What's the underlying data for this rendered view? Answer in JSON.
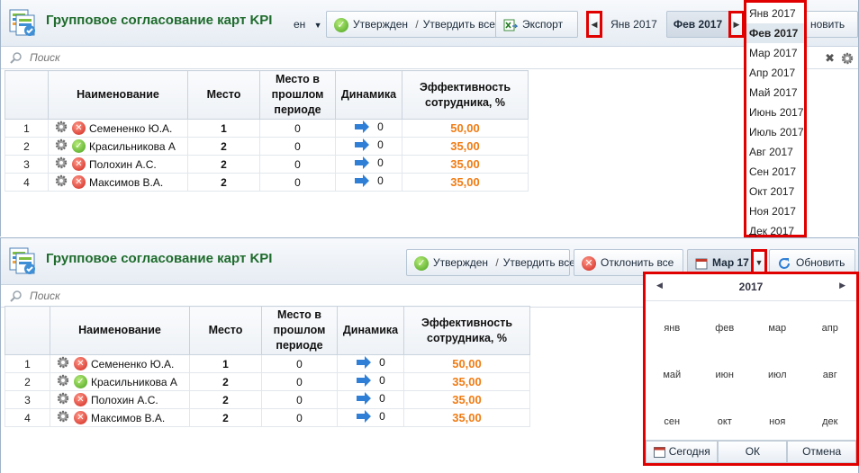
{
  "panel1": {
    "title": "Групповое согласование карт KPI",
    "toolbar": {
      "cut_label": "ен",
      "approve_label": "Утвержден",
      "approve_all_label": "Утвердить все",
      "separator": "/",
      "export_label": "Экспорт",
      "month_prev": "Янв 2017",
      "month_current": "Фев 2017",
      "refresh_label": "новить"
    },
    "search_placeholder": "Поиск"
  },
  "panel2": {
    "title": "Групповое согласование карт KPI",
    "toolbar": {
      "approve_label": "Утвержден",
      "separator": "/",
      "approve_all_label": "Утвердить все",
      "reject_all_label": "Отклонить все",
      "month_value": "Мар 17",
      "refresh_label": "Обновить"
    },
    "search_placeholder": "Поиск"
  },
  "columns": {
    "name": "Наименование",
    "place": "Место",
    "prev": "Место в прошлом периоде",
    "dynamics": "Динамика",
    "efficiency": "Эффективность сотрудника, %"
  },
  "rows": [
    {
      "num": "1",
      "name": "Семененко Ю.А.",
      "status": "rejected",
      "place": "1",
      "prev": "0",
      "dyn": "0",
      "eff": "50,00"
    },
    {
      "num": "2",
      "name": "Красильникова А",
      "status": "approved",
      "place": "2",
      "prev": "0",
      "dyn": "0",
      "eff": "35,00"
    },
    {
      "num": "3",
      "name": "Полохин А.С.",
      "status": "rejected",
      "place": "2",
      "prev": "0",
      "dyn": "0",
      "eff": "35,00"
    },
    {
      "num": "4",
      "name": "Максимов В.А.",
      "status": "rejected",
      "place": "2",
      "prev": "0",
      "dyn": "0",
      "eff": "35,00"
    }
  ],
  "month_dropdown": [
    "Янв 2017",
    "Фев 2017",
    "Мар 2017",
    "Апр 2017",
    "Май 2017",
    "Июнь 2017",
    "Июль 2017",
    "Авг 2017",
    "Сен 2017",
    "Окт 2017",
    "Ноя 2017",
    "Дек 2017"
  ],
  "month_dropdown_selected": "Фев 2017",
  "calendar": {
    "year": "2017",
    "months": [
      "янв",
      "фев",
      "мар",
      "апр",
      "май",
      "июн",
      "июл",
      "авг",
      "сен",
      "окт",
      "ноя",
      "дек"
    ],
    "today_label": "Сегодня",
    "ok_label": "ОК",
    "cancel_label": "Отмена"
  },
  "colors": {
    "title": "#1e6b2c",
    "efficiency": "#f07c14",
    "highlight": "#e00000",
    "dyn_arrow": "#2f7fd6"
  }
}
